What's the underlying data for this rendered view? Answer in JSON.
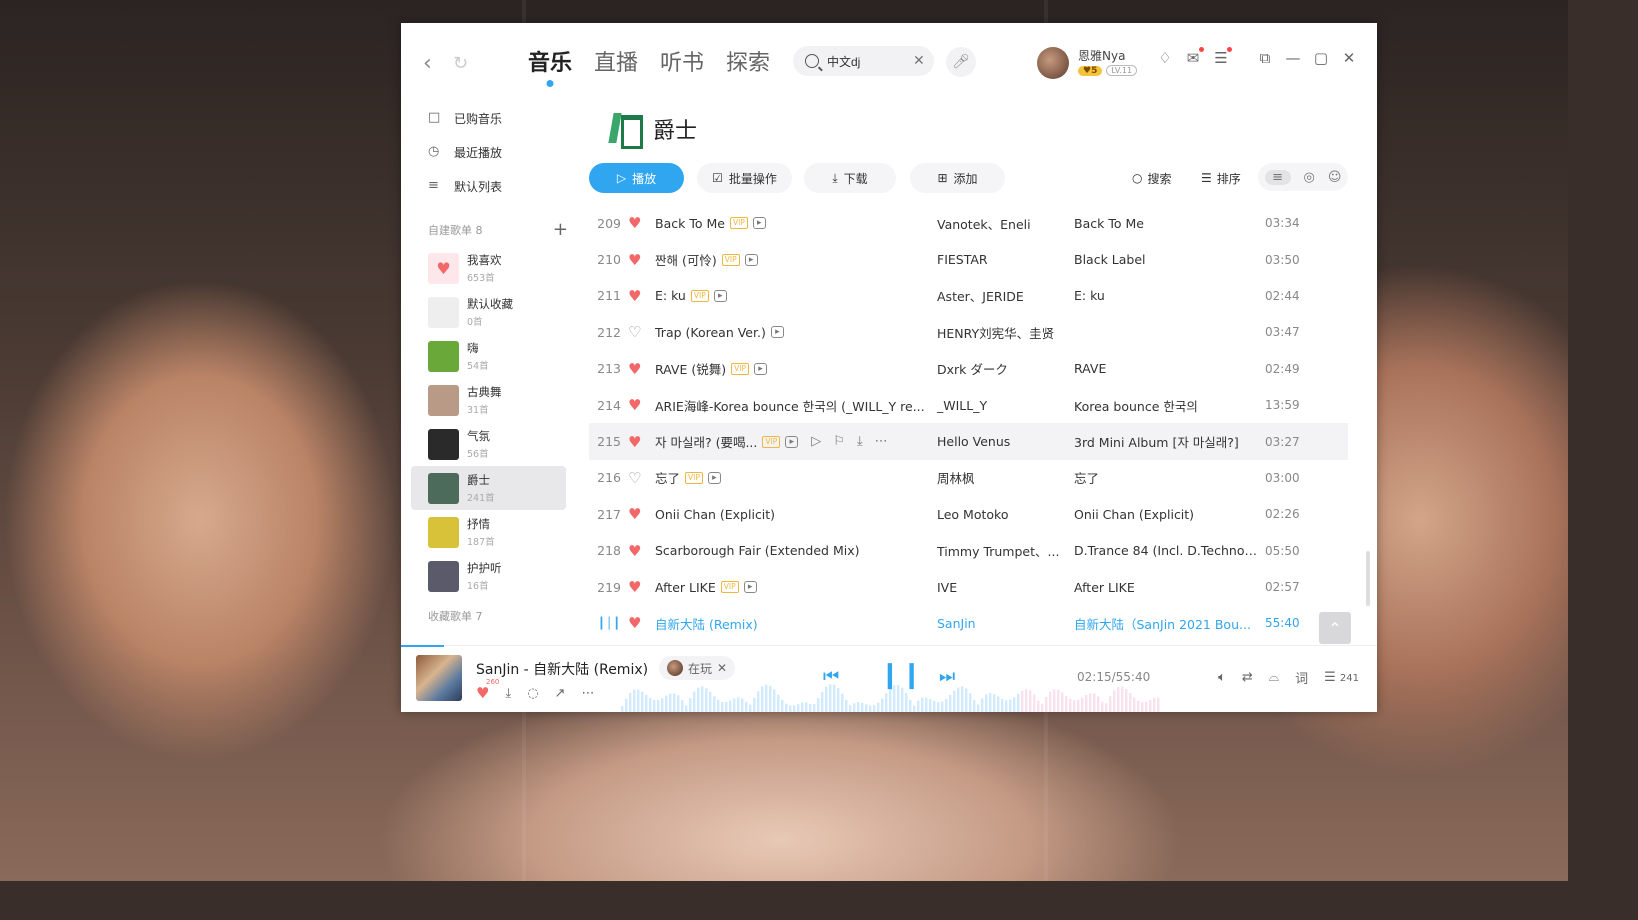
{
  "window": {
    "nav": {
      "back_icon": "chevron-left-icon",
      "refresh_icon": "refresh-icon"
    },
    "main_tabs": [
      {
        "label": "音乐",
        "active": true
      },
      {
        "label": "直播",
        "active": false
      },
      {
        "label": "听书",
        "active": false
      },
      {
        "label": "探索",
        "active": false
      }
    ],
    "search": {
      "value": "中文dj",
      "icon": "search-icon"
    },
    "user": {
      "name": "恩雅Nya",
      "vip_level": "5",
      "level": "LV.11"
    },
    "accent_color": "#31a6f0",
    "heart_color": "#f26767"
  },
  "sidebar": {
    "items": [
      {
        "label": "已购音乐",
        "icon": "purchased-icon"
      },
      {
        "label": "最近播放",
        "icon": "clock-icon"
      },
      {
        "label": "默认列表",
        "icon": "list-icon"
      }
    ],
    "created_section": "自建歌单 8",
    "collected_section": "收藏歌单 7",
    "playlists": [
      {
        "name": "我喜欢",
        "count": "653首",
        "color": "#fde7ea",
        "active": false
      },
      {
        "name": "默认收藏",
        "count": "0首",
        "color": "#eeeeee",
        "active": false
      },
      {
        "name": "嗨",
        "count": "54首",
        "color": "#6aa83a",
        "active": false
      },
      {
        "name": "古典舞",
        "count": "31首",
        "color": "#b89a86",
        "active": false
      },
      {
        "name": "气氛",
        "count": "56首",
        "color": "#2a2a2a",
        "active": false
      },
      {
        "name": "爵士",
        "count": "241首",
        "color": "#4d6b5a",
        "active": true
      },
      {
        "name": "抒情",
        "count": "187首",
        "color": "#d8c23a",
        "active": false
      },
      {
        "name": "护护听",
        "count": "16首",
        "color": "#5a5a6a",
        "active": false
      }
    ]
  },
  "playlist": {
    "title": "爵士",
    "toolbar": {
      "play": "播放",
      "batch": "批量操作",
      "download": "下载",
      "add": "添加",
      "search": "搜索",
      "sort": "排序"
    },
    "songs": [
      {
        "num": "209",
        "liked": true,
        "title": "Back To Me",
        "vip": true,
        "mv": true,
        "artist": "Vanotek、Eneli",
        "album": "Back To Me",
        "duration": "03:34"
      },
      {
        "num": "210",
        "liked": true,
        "title": "짠해 (可怜)",
        "vip": true,
        "mv": true,
        "artist": "FIESTAR",
        "album": "Black Label",
        "duration": "03:50"
      },
      {
        "num": "211",
        "liked": true,
        "title": "E: ku",
        "vip": true,
        "mv": true,
        "artist": "Aster、JERIDE",
        "album": "E: ku",
        "duration": "02:44"
      },
      {
        "num": "212",
        "liked": false,
        "title": "Trap (Korean Ver.)",
        "vip": false,
        "mv": true,
        "artist": "HENRY刘宪华、圭贤",
        "album": "",
        "duration": "03:47"
      },
      {
        "num": "213",
        "liked": true,
        "title": "RAVE (锐舞)",
        "vip": true,
        "mv": true,
        "artist": "Dxrk ダーク",
        "album": "RAVE",
        "duration": "02:49"
      },
      {
        "num": "214",
        "liked": true,
        "title": "ARIE海峰-Korea bounce 한국의 (_WILL_Y re...",
        "vip": false,
        "mv": false,
        "artist": "_WILL_Y",
        "album": "Korea bounce 한국의",
        "duration": "13:59"
      },
      {
        "num": "215",
        "liked": true,
        "title": "자 마실래? (要喝...",
        "vip": true,
        "mv": true,
        "artist": "Hello Venus",
        "album": "3rd Mini Album [자 마실래?]",
        "duration": "03:27",
        "hover": true
      },
      {
        "num": "216",
        "liked": false,
        "title": "忘了",
        "vip": true,
        "mv": true,
        "artist": "周林枫",
        "album": "忘了",
        "duration": "03:00"
      },
      {
        "num": "217",
        "liked": true,
        "title": "Onii Chan (Explicit)",
        "vip": false,
        "mv": false,
        "artist": "Leo Motoko",
        "album": "Onii Chan (Explicit)",
        "duration": "02:26"
      },
      {
        "num": "218",
        "liked": true,
        "title": "Scarborough Fair (Extended Mix)",
        "vip": false,
        "mv": false,
        "artist": "Timmy Trumpet、...",
        "album": "D.Trance 84 (Incl. D.Techno ...",
        "duration": "05:50"
      },
      {
        "num": "219",
        "liked": true,
        "title": "After LIKE",
        "vip": true,
        "mv": true,
        "artist": "IVE",
        "album": "After LIKE",
        "duration": "02:57"
      },
      {
        "num": "",
        "liked": true,
        "title": "自新大陆 (Remix)",
        "vip": false,
        "mv": false,
        "artist": "SanJin",
        "album": "自新大陆（SanJin 2021 Bou...",
        "duration": "55:40",
        "playing": true
      }
    ]
  },
  "player": {
    "title": "SanJin - 自新大陆 (Remix)",
    "listening_tag": "在玩",
    "like_count": "260",
    "time": "02:15/55:40",
    "lyric": "词",
    "queue_count": "241"
  }
}
